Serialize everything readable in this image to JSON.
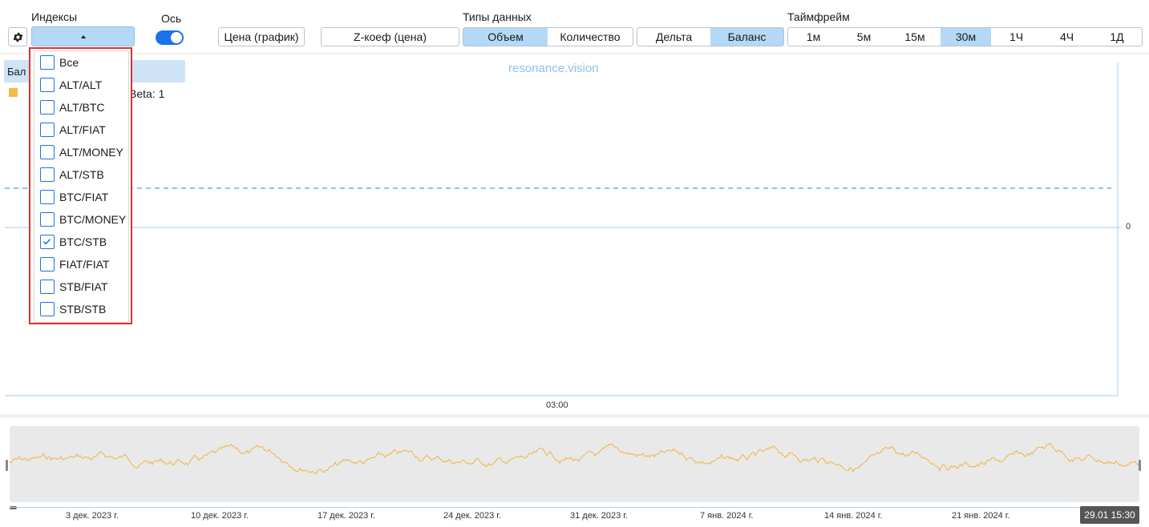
{
  "toolbar": {
    "indices_label": "Индексы",
    "axis_label": "Ось",
    "data_types_label": "Типы данных",
    "timeframe_label": "Таймфрейм",
    "price_chart_label": "Цена (график)",
    "zcoef_label": "Z-коеф (цена)",
    "data_types": [
      {
        "label": "Объем",
        "active": true
      },
      {
        "label": "Количество",
        "active": false
      }
    ],
    "modes": [
      {
        "label": "Дельта",
        "active": false
      },
      {
        "label": "Баланс",
        "active": true
      }
    ],
    "timeframes": [
      {
        "label": "1м",
        "active": false
      },
      {
        "label": "5м",
        "active": false
      },
      {
        "label": "15м",
        "active": false
      },
      {
        "label": "30м",
        "active": true
      },
      {
        "label": "1Ч",
        "active": false
      },
      {
        "label": "4Ч",
        "active": false
      },
      {
        "label": "1Д",
        "active": false
      }
    ],
    "axis_toggle_on": true
  },
  "chart": {
    "legend_title_partial": "Бал",
    "legend_beta": "Beta: 1",
    "watermark": "resonance.vision",
    "y_zero_label": "0",
    "x_time_label": "03:00",
    "series_color": "#f2bb47"
  },
  "dropdown": {
    "items": [
      {
        "label": "Все",
        "checked": false
      },
      {
        "label": "ALT/ALT",
        "checked": false
      },
      {
        "label": "ALT/BTC",
        "checked": false
      },
      {
        "label": "ALT/FIAT",
        "checked": false
      },
      {
        "label": "ALT/MONEY",
        "checked": false
      },
      {
        "label": "ALT/STB",
        "checked": false
      },
      {
        "label": "BTC/FIAT",
        "checked": false
      },
      {
        "label": "BTC/MONEY",
        "checked": false
      },
      {
        "label": "BTC/STB",
        "checked": true
      },
      {
        "label": "FIAT/FIAT",
        "checked": false
      },
      {
        "label": "STB/FIAT",
        "checked": false
      },
      {
        "label": "STB/STB",
        "checked": false
      }
    ]
  },
  "navigator": {
    "dates": [
      "3 дек. 2023 г.",
      "10 дек. 2023 г.",
      "17 дек. 2023 г.",
      "24 дек. 2023 г.",
      "31 дек. 2023 г.",
      "7 янв. 2024 г.",
      "14 янв. 2024 г.",
      "21 янв. 2024 г."
    ],
    "current_badge": "29.01 15:30",
    "line_color": "#f0b23f"
  }
}
